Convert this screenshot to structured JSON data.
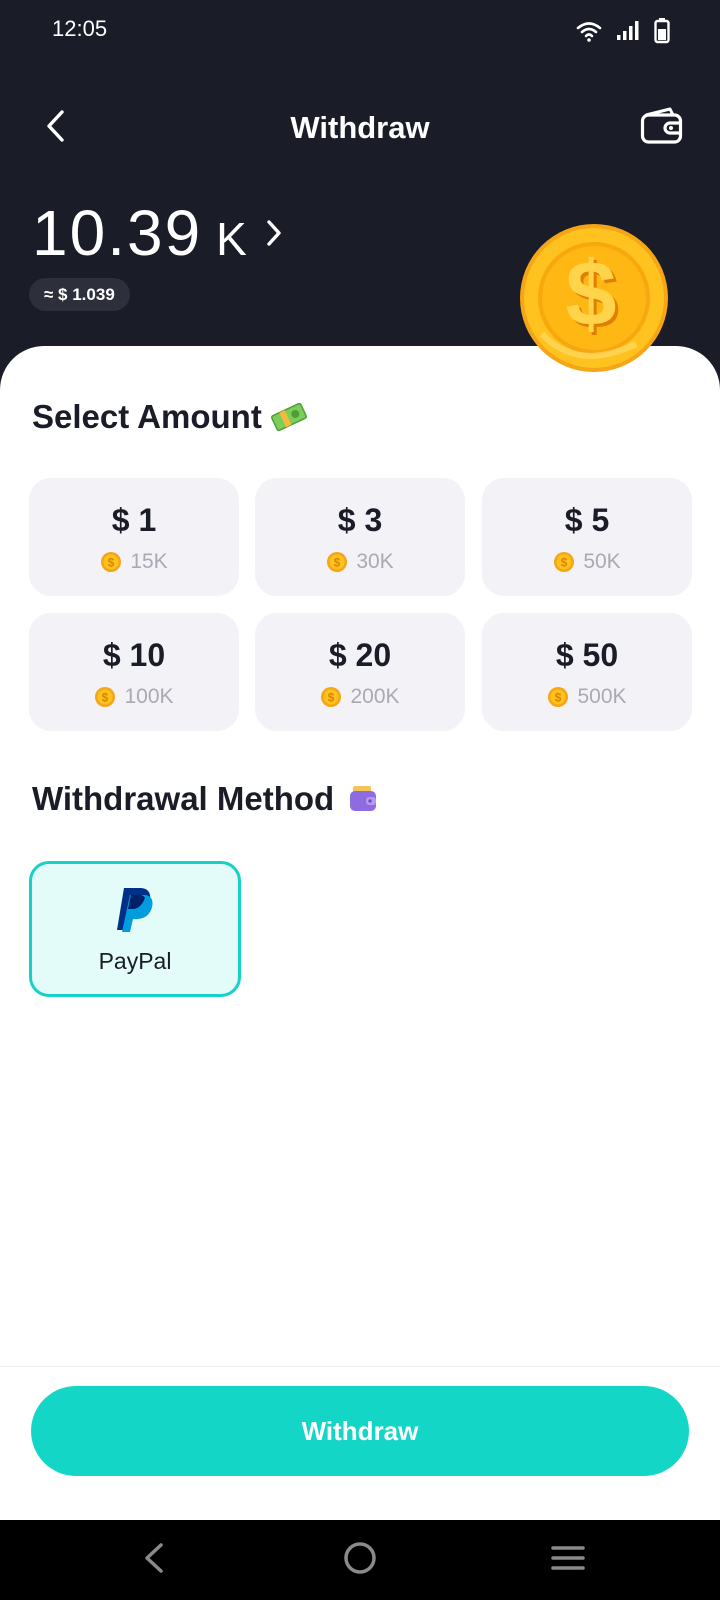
{
  "status_bar": {
    "time": "12:05",
    "icons": [
      "wifi-icon",
      "signal-icon",
      "battery-icon"
    ]
  },
  "header": {
    "title": "Withdraw",
    "back_icon": "chevron-left-icon",
    "wallet_icon": "wallet-icon"
  },
  "balance": {
    "value": "10.39",
    "unit": "K",
    "usd_equivalent": "≈ $ 1.039"
  },
  "select_amount": {
    "title": "Select Amount",
    "title_icon": "money-emoji-icon",
    "options": [
      {
        "usd": "$ 1",
        "coins": "15K"
      },
      {
        "usd": "$ 3",
        "coins": "30K"
      },
      {
        "usd": "$ 5",
        "coins": "50K"
      },
      {
        "usd": "$ 10",
        "coins": "100K"
      },
      {
        "usd": "$ 20",
        "coins": "200K"
      },
      {
        "usd": "$ 50",
        "coins": "500K"
      }
    ]
  },
  "withdrawal_method": {
    "title": "Withdrawal Method",
    "title_icon": "purse-emoji-icon",
    "methods": [
      {
        "label": "PayPal",
        "icon": "paypal-icon",
        "selected": true
      }
    ]
  },
  "actions": {
    "withdraw_label": "Withdraw"
  },
  "colors": {
    "header_bg": "#1a1c27",
    "accent": "#13d6c6",
    "tile_bg": "#f2f2f7",
    "selected_bg": "#e3fbf9"
  }
}
